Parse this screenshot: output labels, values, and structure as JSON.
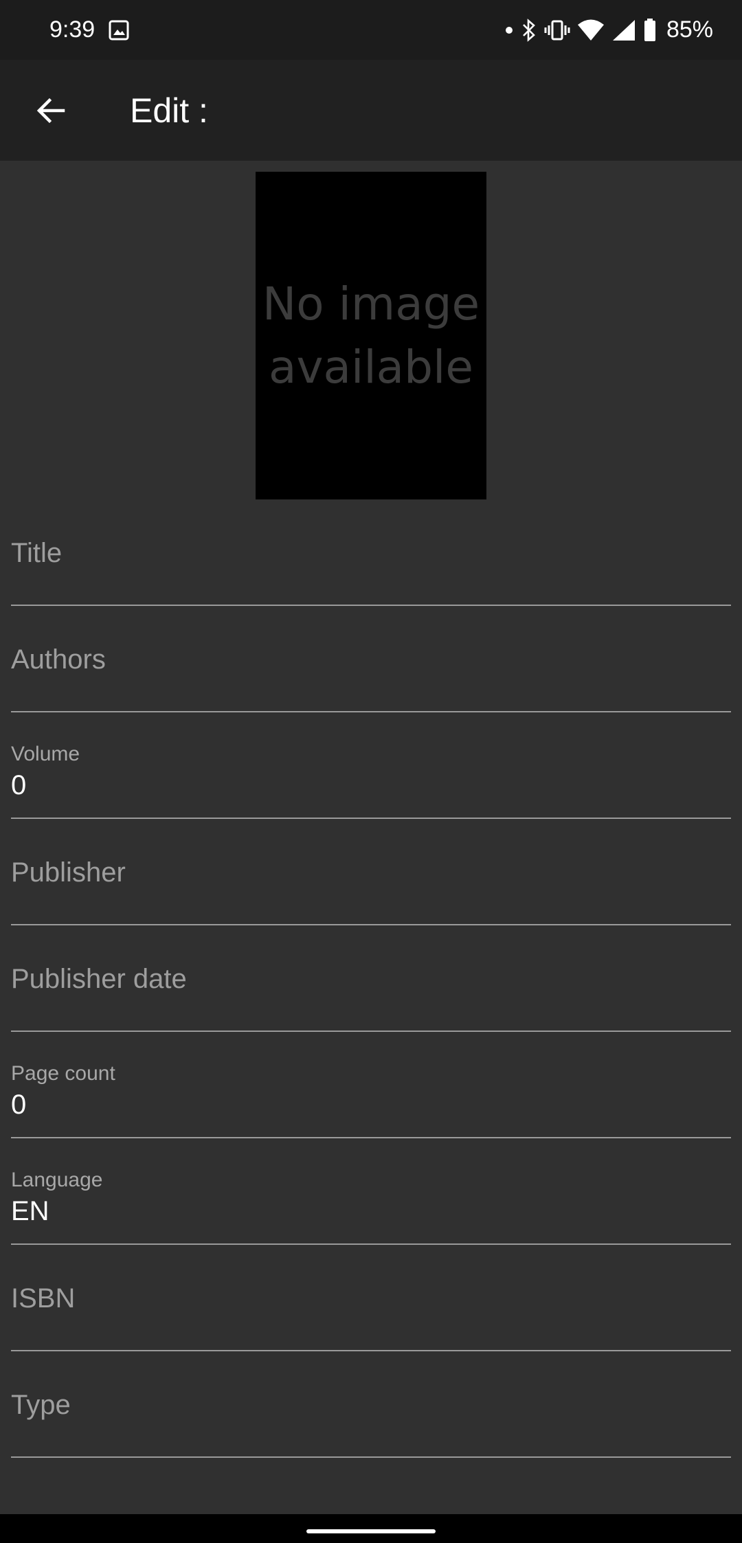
{
  "status_bar": {
    "time": "9:39",
    "battery": "85%",
    "icons": [
      "image-icon",
      "dot-icon",
      "bluetooth-icon",
      "vibrate-icon",
      "wifi-icon",
      "signal-icon",
      "battery-icon"
    ]
  },
  "app_bar": {
    "title": "Edit :",
    "back_icon": "arrow-back-icon"
  },
  "cover": {
    "placeholder_line1": "No image",
    "placeholder_line2": "available"
  },
  "form": {
    "title": {
      "hint": "Title"
    },
    "authors": {
      "hint": "Authors"
    },
    "volume": {
      "label": "Volume",
      "value": "0"
    },
    "publisher": {
      "hint": "Publisher"
    },
    "publisher_date": {
      "hint": "Publisher date"
    },
    "page_count": {
      "label": "Page count",
      "value": "0"
    },
    "language": {
      "label": "Language",
      "value": "EN"
    },
    "isbn": {
      "hint": "ISBN"
    },
    "type": {
      "hint": "Type"
    }
  },
  "colors": {
    "background": "#303030",
    "app_bar": "#212121",
    "status_bar": "#1c1c1c",
    "hint_text": "#9e9e9e",
    "underline": "#9a9a9a"
  }
}
